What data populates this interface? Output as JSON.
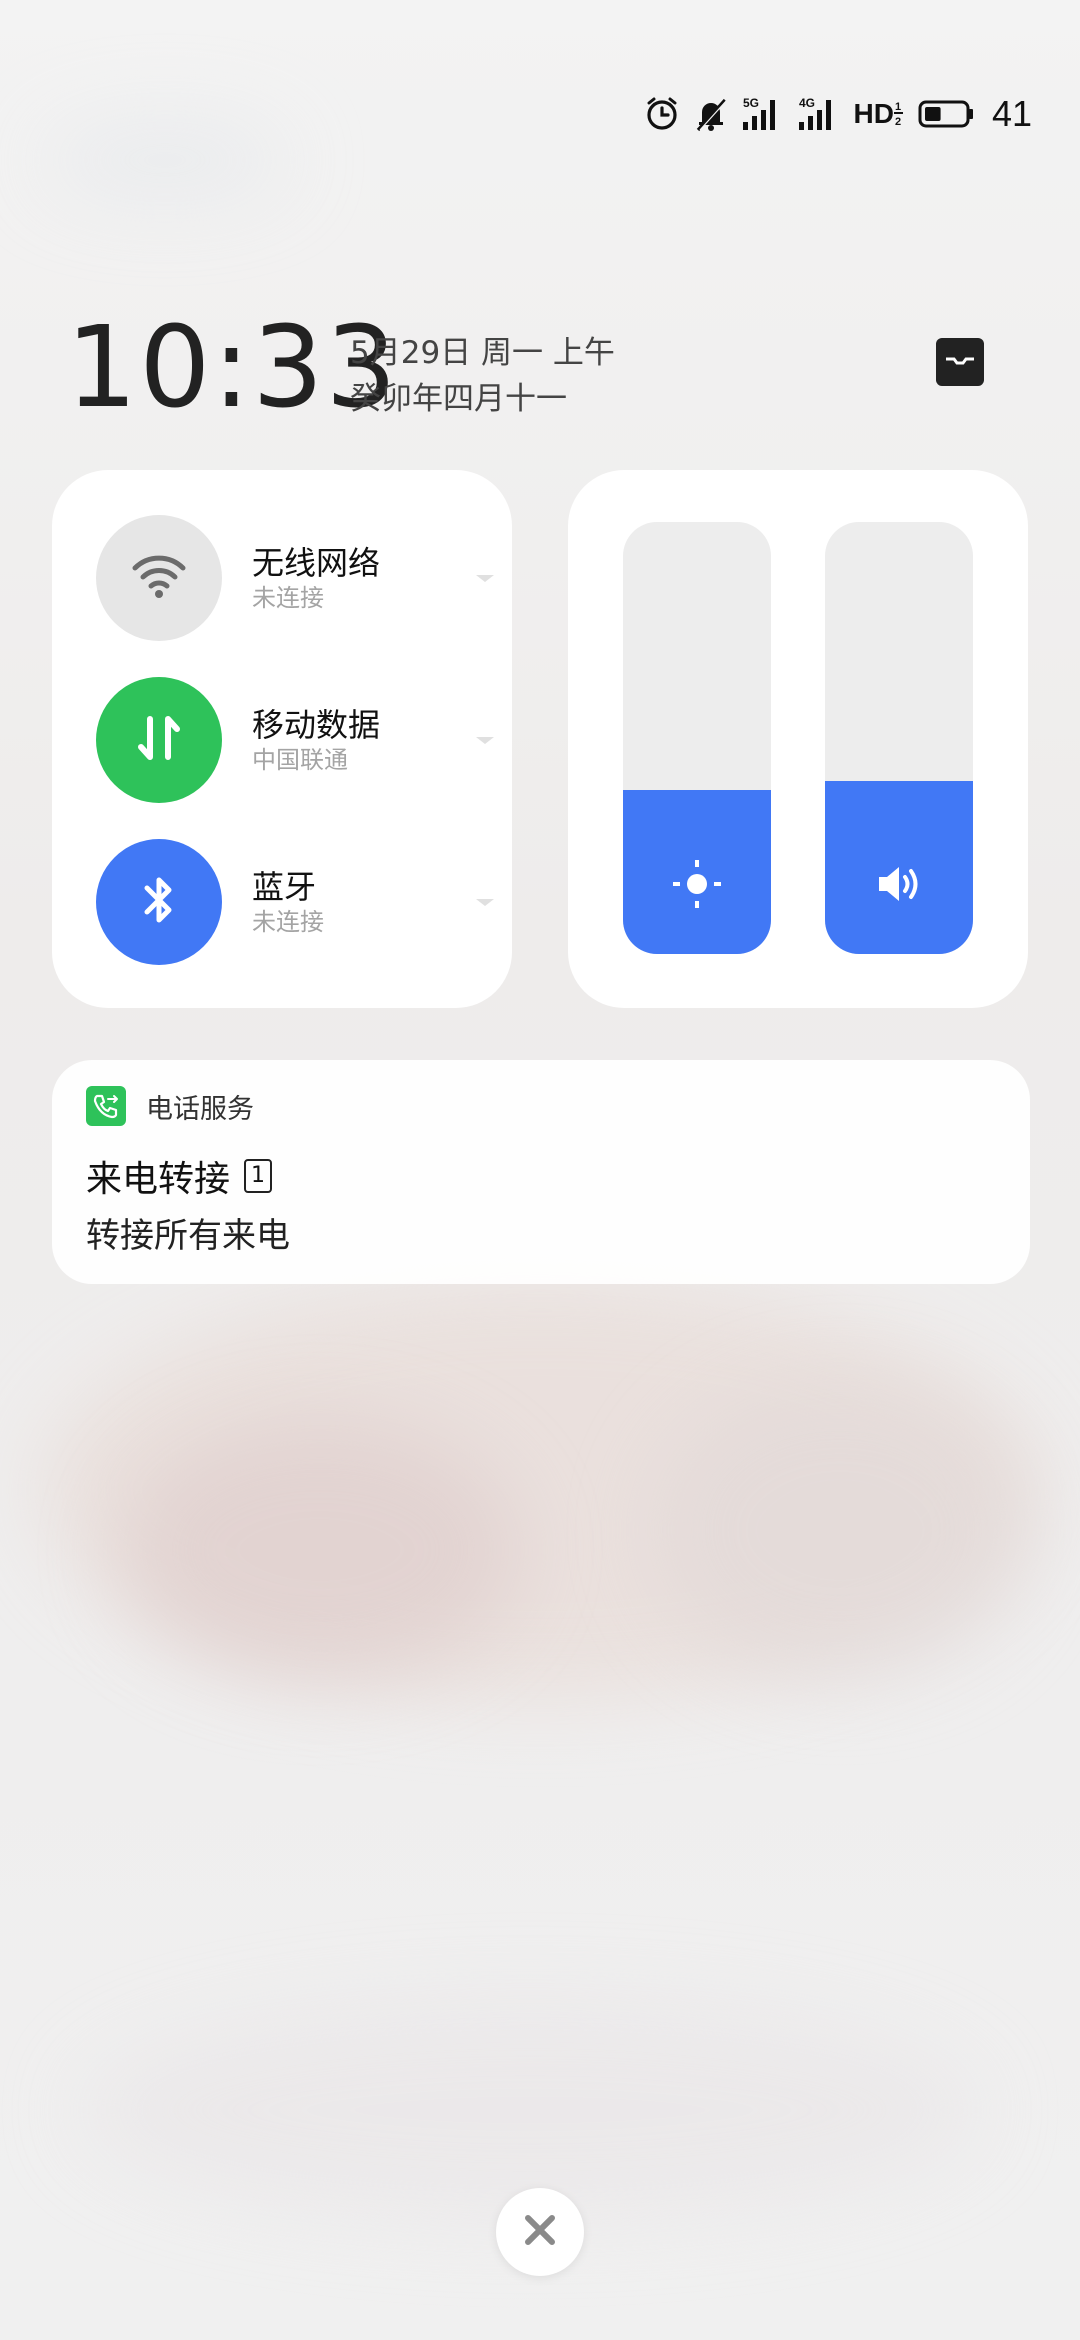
{
  "status_bar": {
    "icons": [
      "alarm-icon",
      "mute-icon",
      "signal-5g-icon",
      "signal-4g-icon",
      "hd-icon",
      "battery-icon"
    ],
    "network_1": "5G",
    "network_2": "4G",
    "hd_label": "HD",
    "battery_percent": "41",
    "battery_level": 0.41
  },
  "clock": {
    "time": "10:33",
    "date_line": "5月29日 周一 上午",
    "lunar_line": "癸卯年四月十一"
  },
  "connectivity": {
    "wifi": {
      "title": "无线网络",
      "subtitle": "未连接",
      "icon": "wifi-icon",
      "active": false
    },
    "mobile_data": {
      "title": "移动数据",
      "subtitle": "中国联通",
      "icon": "data-transfer-icon",
      "active": true
    },
    "bluetooth": {
      "title": "蓝牙",
      "subtitle": "未连接",
      "icon": "bluetooth-icon",
      "active": true
    }
  },
  "sliders": {
    "brightness": {
      "icon": "brightness-icon",
      "level": 0.38
    },
    "volume": {
      "icon": "volume-icon",
      "level": 0.4
    }
  },
  "notification": {
    "app_name": "电话服务",
    "app_icon": "phone-forward-icon",
    "title": "来电转接",
    "sim_badge": "1",
    "body": "转接所有来电"
  },
  "colors": {
    "accent_blue": "#4178f5",
    "accent_green": "#2ec25a",
    "inactive_gray": "#e6e6e6"
  },
  "close_button": {
    "icon": "close-icon"
  }
}
